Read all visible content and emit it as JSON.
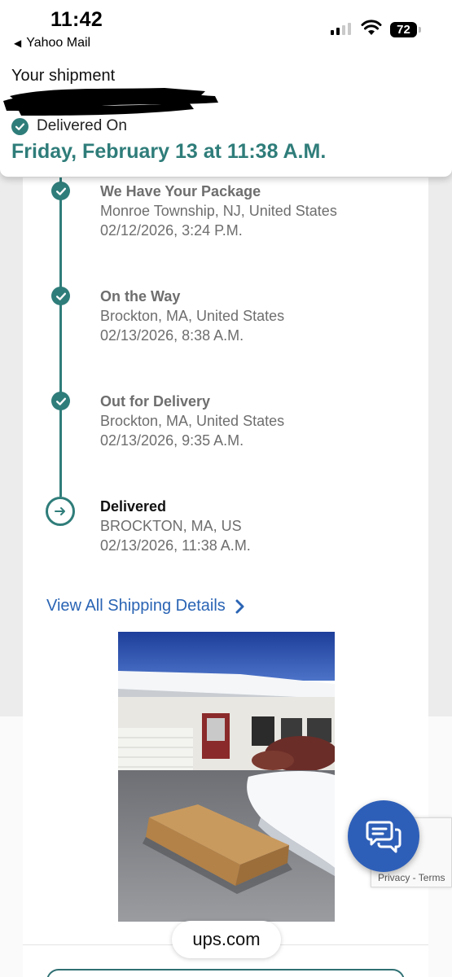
{
  "status_bar": {
    "time": "11:42",
    "back_app": "Yahoo Mail",
    "battery": "72"
  },
  "header": {
    "title": "Your shipment",
    "status_label": "Delivered On",
    "delivery_date": "Friday, February 13 at 11:38 A.M."
  },
  "timeline": [
    {
      "title": "We Have Your Package",
      "location": "Monroe Township, NJ, United States",
      "datetime": "02/12/2026, 3:24 P.M."
    },
    {
      "title": "On the Way",
      "location": "Brockton, MA, United States",
      "datetime": "02/13/2026, 8:38 A.M."
    },
    {
      "title": "Out for Delivery",
      "location": "Brockton, MA, United States",
      "datetime": "02/13/2026, 9:35 A.M."
    },
    {
      "title": "Delivered",
      "location": "BROCKTON, MA, US",
      "datetime": "02/13/2026, 11:38 A.M."
    }
  ],
  "links": {
    "view_all": "View All Shipping Details"
  },
  "recaptcha": {
    "privacy": "Privacy",
    "separator": " - ",
    "terms": "Terms"
  },
  "browser": {
    "url": "ups.com"
  },
  "colors": {
    "accent": "#2f7d7a",
    "link": "#2a64b4",
    "chat": "#2e5fb8"
  },
  "icons": {
    "check": "check-circle-icon",
    "current": "arrow-circle-icon",
    "chevron": "chevron-right-icon",
    "chat": "chat-bubbles-icon"
  }
}
